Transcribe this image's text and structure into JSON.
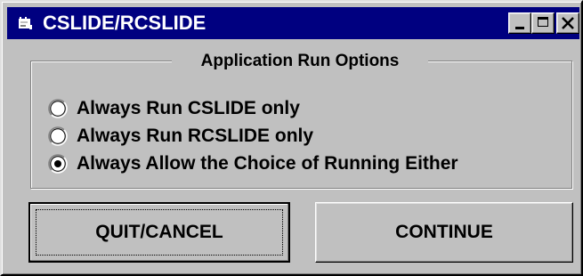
{
  "window": {
    "title": "CSLIDE/RCSLIDE",
    "icon": "app-icon",
    "controls": [
      "minimize-icon",
      "maximize-icon",
      "close-icon"
    ]
  },
  "options_group": {
    "label": "Application Run Options",
    "options": [
      {
        "label": "Always Run CSLIDE only",
        "selected": false
      },
      {
        "label": "Always Run RCSLIDE only",
        "selected": false
      },
      {
        "label": "Always Allow the Choice of Running Either",
        "selected": true
      }
    ]
  },
  "buttons": {
    "quit_label": "QUIT/CANCEL",
    "continue_label": "CONTINUE"
  },
  "colors": {
    "face": "#c0c0c0",
    "titlebar": "#000080",
    "title_text": "#ffffff"
  }
}
